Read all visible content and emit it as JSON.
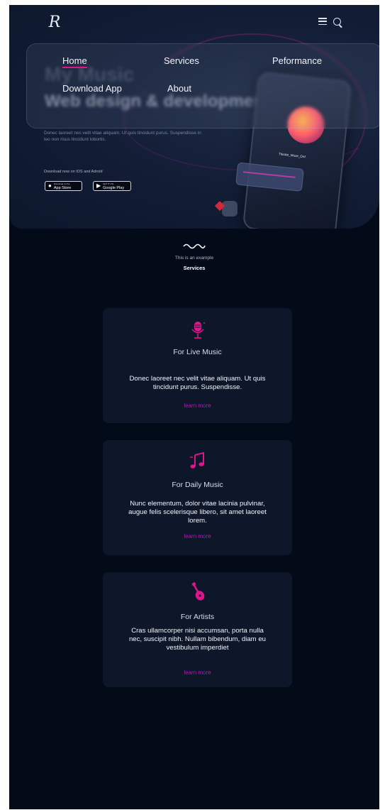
{
  "brand": {
    "logo_letter": "R"
  },
  "header_icons": {
    "menu": "menu-icon",
    "search": "search-icon"
  },
  "nav": {
    "home": "Home",
    "services": "Services",
    "performance": "Peformance",
    "download": "Download App",
    "about": "About"
  },
  "hero": {
    "small_title": "My Music",
    "title": "Web design & development",
    "description": "Donec laoreet nec velit vitae aliquam. Ut quis tincidunt purus. Suspendisse in leo non risus tincidunt lobortis.",
    "download_label": "Download now on IOS and Adroid",
    "app_store_small": "Download on the",
    "app_store": "App Store",
    "google_play_small": "GET IT ON",
    "google_play": "Google Play",
    "song_title": "Thinkin_Muse_Ord"
  },
  "section": {
    "subtitle": "This is an example",
    "title": "Services"
  },
  "cards": [
    {
      "icon": "microphone-icon",
      "title": "For Live Music",
      "text": "Donec laoreet nec velit vitae aliquam. Ut quis tincidunt purus. Suspendisse.",
      "link": "learn more"
    },
    {
      "icon": "music-notes-icon",
      "title": "For Daily Music",
      "text": "Nunc elementum, dolor vitae lacinia pulvinar, augue felis scelerisque libero, sit amet laoreet lorem.",
      "link": "learn more"
    },
    {
      "icon": "guitar-icon",
      "title": "For Artists",
      "text": "Cras ullamcorper nisi accumsan, porta nulla nec, suscipit nibh. Nullam bibendum, diam eu vestibulum imperdiet",
      "link": "learn more"
    }
  ],
  "colors": {
    "background": "#030a18",
    "hero": "#141f38",
    "card": "#0d1729",
    "accent": "#e0148c",
    "link": "#b315b8"
  }
}
